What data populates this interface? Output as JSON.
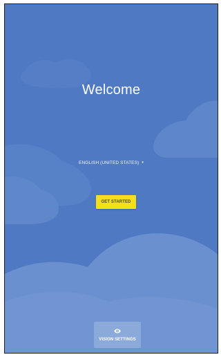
{
  "screen": {
    "title": "Welcome",
    "language_label": "ENGLISH (UNITED STATES)",
    "language_caret": "▾",
    "start_button_label": "GET STARTED",
    "vision_settings_label": "VISION SETTINGS"
  },
  "icons": {
    "language_dropdown": "chevron-down-icon",
    "vision": "eye-icon"
  },
  "colors": {
    "background": "#4f79c3",
    "start_button": "#f4e018",
    "text": "#ffffff"
  }
}
